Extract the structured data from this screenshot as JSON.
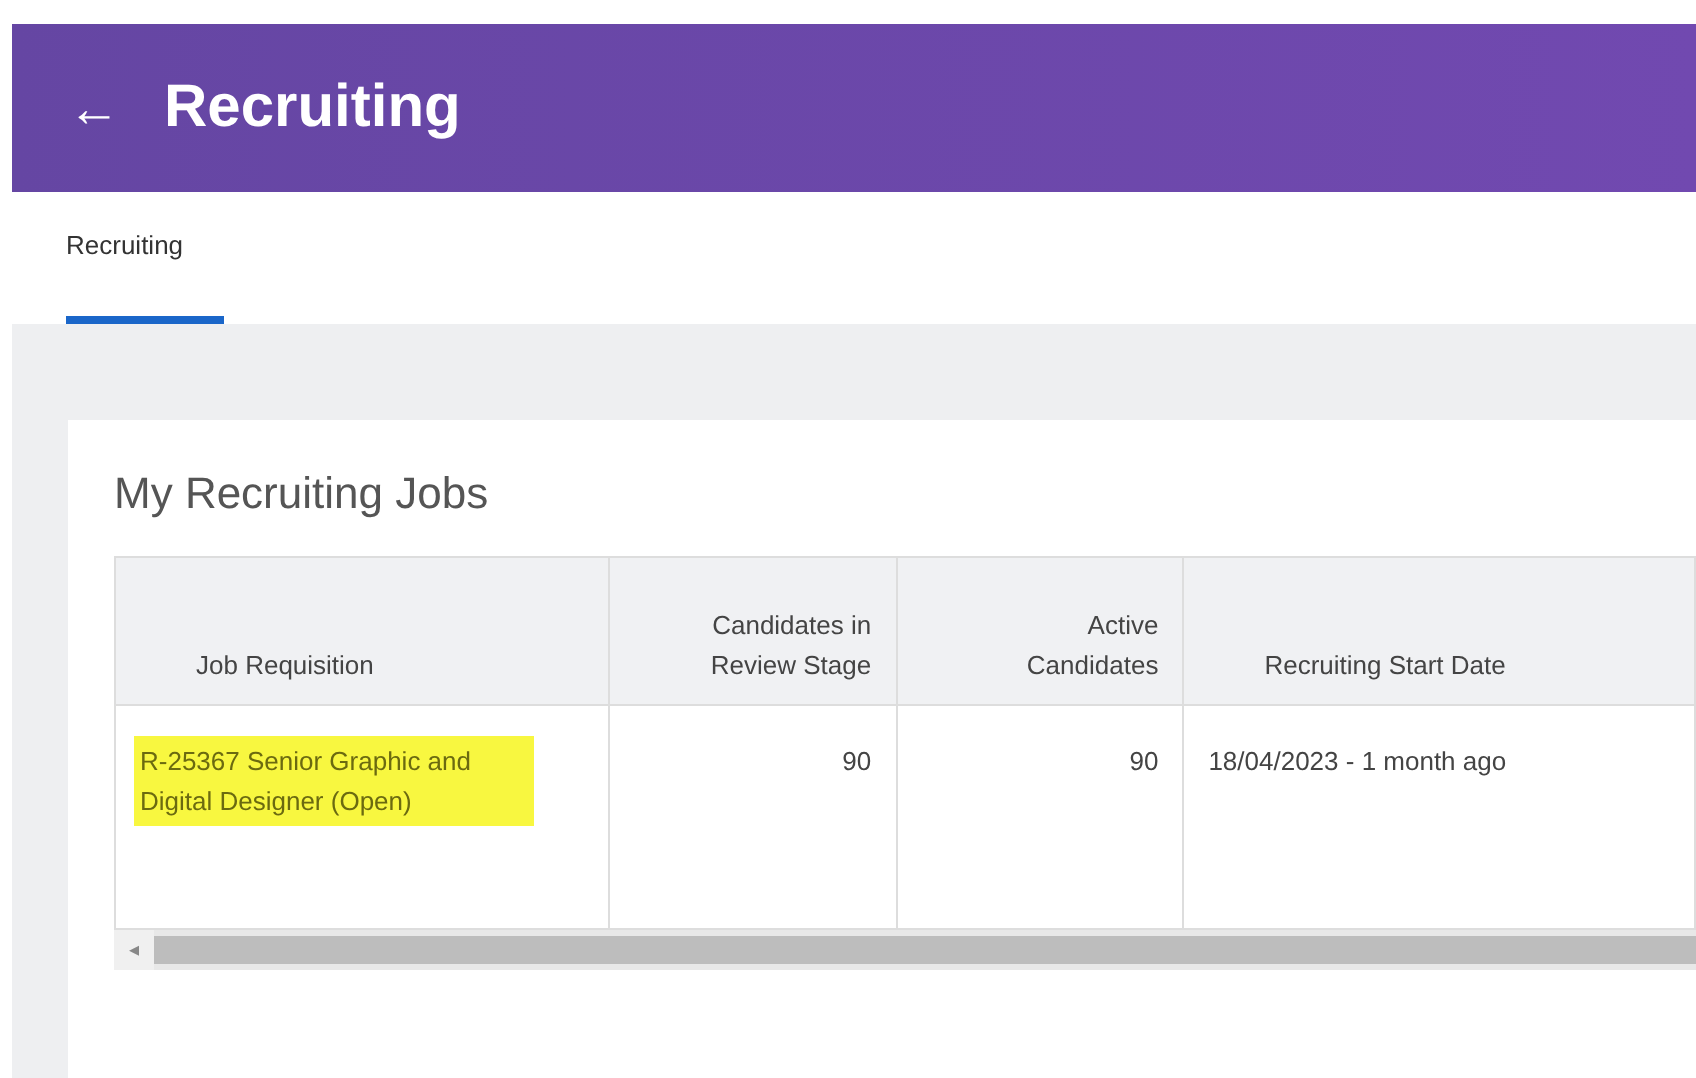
{
  "header": {
    "back_icon": "←",
    "title": "Recruiting"
  },
  "tabs": [
    {
      "label": "Recruiting",
      "selected": true
    }
  ],
  "card": {
    "title": "My Recruiting Jobs",
    "table": {
      "columns": [
        "Job Requisition",
        "Candidates in Review Stage",
        "Active Candidates",
        "Recruiting Start Date"
      ],
      "rows": [
        {
          "job": "R-25367 Senior Graphic and Digital Designer (Open)",
          "highlighted": true,
          "in_review": "90",
          "active": "90",
          "start_date": "18/04/2023 - 1 month ago"
        }
      ]
    },
    "scroll_left": "◂"
  }
}
